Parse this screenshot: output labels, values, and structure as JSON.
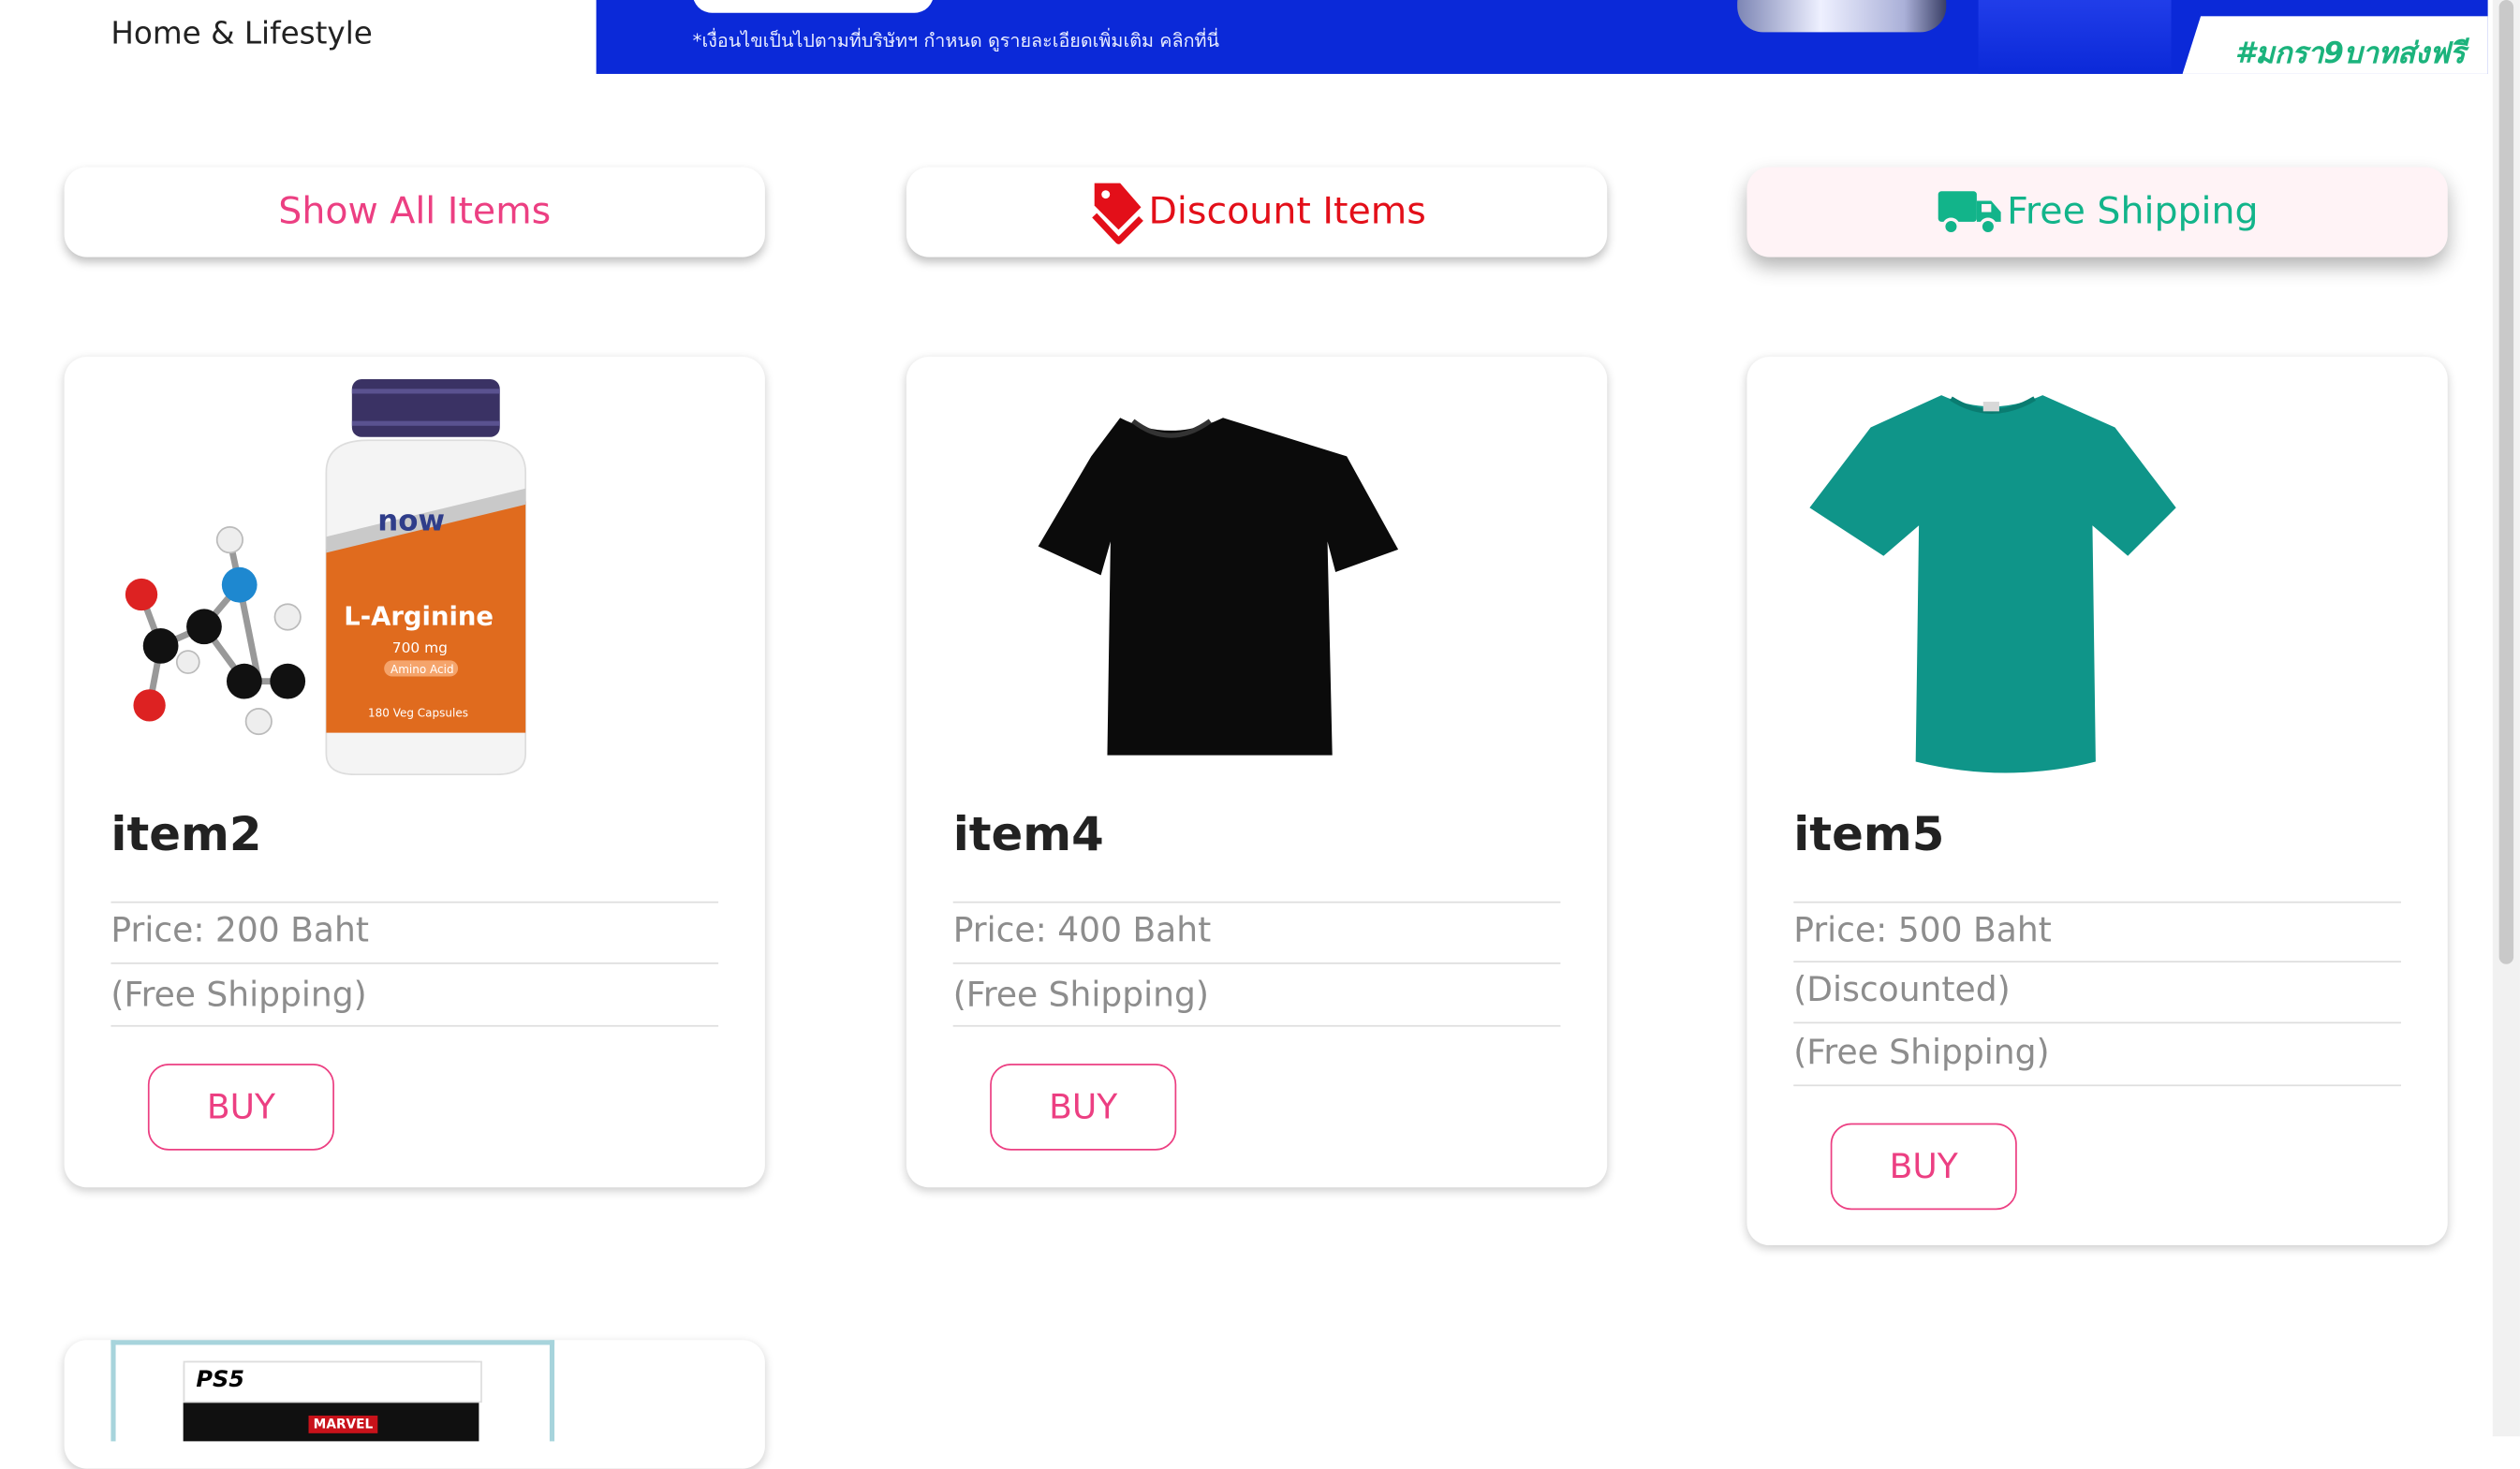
{
  "header": {
    "category_label": "Home & Lifestyle",
    "banner": {
      "note": "*เงื่อนไขเป็นไปตามที่บริษัทฯ กำหนด ดูรายละเอียดเพิ่มเติม คลิกที่นี่",
      "hashtag": "#มกรา9บาทส่งฟรี",
      "background": "#0b29d8"
    }
  },
  "filters": {
    "show_all": "Show All Items",
    "discount": "Discount Items",
    "free_shipping": "Free Shipping",
    "active": "free_shipping"
  },
  "products": [
    {
      "name": "item2",
      "price": "Price: 200 Baht",
      "tags": [
        "(Free Shipping)"
      ],
      "buy_label": "BUY",
      "image": "l-arginine-bottle"
    },
    {
      "name": "item4",
      "price": "Price: 400 Baht",
      "tags": [
        "(Free Shipping)"
      ],
      "buy_label": "BUY",
      "image": "black-tshirt"
    },
    {
      "name": "item5",
      "price": "Price: 500 Baht",
      "tags": [
        "(Discounted)",
        "(Free Shipping)"
      ],
      "buy_label": "BUY",
      "image": "teal-tshirt"
    }
  ],
  "partial_product": {
    "box_brand": "PS5",
    "box_publisher": "MARVEL"
  },
  "bottle": {
    "brand": "now",
    "product": "L-Arginine",
    "dose": "700 mg",
    "sub": "Amino Acid",
    "caps": "180 Veg Capsules"
  },
  "colors": {
    "accent_pink": "#ec3f82",
    "discount_red": "#e30f19",
    "shipping_green": "#12b48a"
  }
}
